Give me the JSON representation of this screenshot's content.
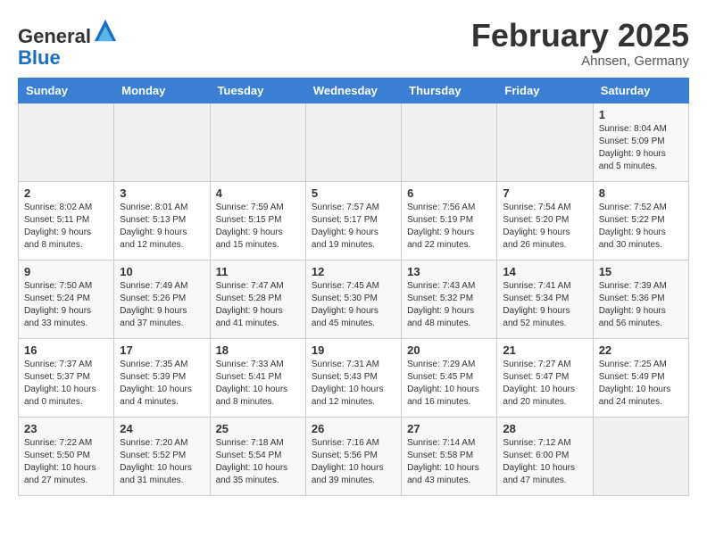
{
  "logo": {
    "general": "General",
    "blue": "Blue"
  },
  "header": {
    "month_year": "February 2025",
    "location": "Ahnsen, Germany"
  },
  "weekdays": [
    "Sunday",
    "Monday",
    "Tuesday",
    "Wednesday",
    "Thursday",
    "Friday",
    "Saturday"
  ],
  "weeks": [
    [
      {
        "day": "",
        "info": ""
      },
      {
        "day": "",
        "info": ""
      },
      {
        "day": "",
        "info": ""
      },
      {
        "day": "",
        "info": ""
      },
      {
        "day": "",
        "info": ""
      },
      {
        "day": "",
        "info": ""
      },
      {
        "day": "1",
        "info": "Sunrise: 8:04 AM\nSunset: 5:09 PM\nDaylight: 9 hours and 5 minutes."
      }
    ],
    [
      {
        "day": "2",
        "info": "Sunrise: 8:02 AM\nSunset: 5:11 PM\nDaylight: 9 hours and 8 minutes."
      },
      {
        "day": "3",
        "info": "Sunrise: 8:01 AM\nSunset: 5:13 PM\nDaylight: 9 hours and 12 minutes."
      },
      {
        "day": "4",
        "info": "Sunrise: 7:59 AM\nSunset: 5:15 PM\nDaylight: 9 hours and 15 minutes."
      },
      {
        "day": "5",
        "info": "Sunrise: 7:57 AM\nSunset: 5:17 PM\nDaylight: 9 hours and 19 minutes."
      },
      {
        "day": "6",
        "info": "Sunrise: 7:56 AM\nSunset: 5:19 PM\nDaylight: 9 hours and 22 minutes."
      },
      {
        "day": "7",
        "info": "Sunrise: 7:54 AM\nSunset: 5:20 PM\nDaylight: 9 hours and 26 minutes."
      },
      {
        "day": "8",
        "info": "Sunrise: 7:52 AM\nSunset: 5:22 PM\nDaylight: 9 hours and 30 minutes."
      }
    ],
    [
      {
        "day": "9",
        "info": "Sunrise: 7:50 AM\nSunset: 5:24 PM\nDaylight: 9 hours and 33 minutes."
      },
      {
        "day": "10",
        "info": "Sunrise: 7:49 AM\nSunset: 5:26 PM\nDaylight: 9 hours and 37 minutes."
      },
      {
        "day": "11",
        "info": "Sunrise: 7:47 AM\nSunset: 5:28 PM\nDaylight: 9 hours and 41 minutes."
      },
      {
        "day": "12",
        "info": "Sunrise: 7:45 AM\nSunset: 5:30 PM\nDaylight: 9 hours and 45 minutes."
      },
      {
        "day": "13",
        "info": "Sunrise: 7:43 AM\nSunset: 5:32 PM\nDaylight: 9 hours and 48 minutes."
      },
      {
        "day": "14",
        "info": "Sunrise: 7:41 AM\nSunset: 5:34 PM\nDaylight: 9 hours and 52 minutes."
      },
      {
        "day": "15",
        "info": "Sunrise: 7:39 AM\nSunset: 5:36 PM\nDaylight: 9 hours and 56 minutes."
      }
    ],
    [
      {
        "day": "16",
        "info": "Sunrise: 7:37 AM\nSunset: 5:37 PM\nDaylight: 10 hours and 0 minutes."
      },
      {
        "day": "17",
        "info": "Sunrise: 7:35 AM\nSunset: 5:39 PM\nDaylight: 10 hours and 4 minutes."
      },
      {
        "day": "18",
        "info": "Sunrise: 7:33 AM\nSunset: 5:41 PM\nDaylight: 10 hours and 8 minutes."
      },
      {
        "day": "19",
        "info": "Sunrise: 7:31 AM\nSunset: 5:43 PM\nDaylight: 10 hours and 12 minutes."
      },
      {
        "day": "20",
        "info": "Sunrise: 7:29 AM\nSunset: 5:45 PM\nDaylight: 10 hours and 16 minutes."
      },
      {
        "day": "21",
        "info": "Sunrise: 7:27 AM\nSunset: 5:47 PM\nDaylight: 10 hours and 20 minutes."
      },
      {
        "day": "22",
        "info": "Sunrise: 7:25 AM\nSunset: 5:49 PM\nDaylight: 10 hours and 24 minutes."
      }
    ],
    [
      {
        "day": "23",
        "info": "Sunrise: 7:22 AM\nSunset: 5:50 PM\nDaylight: 10 hours and 27 minutes."
      },
      {
        "day": "24",
        "info": "Sunrise: 7:20 AM\nSunset: 5:52 PM\nDaylight: 10 hours and 31 minutes."
      },
      {
        "day": "25",
        "info": "Sunrise: 7:18 AM\nSunset: 5:54 PM\nDaylight: 10 hours and 35 minutes."
      },
      {
        "day": "26",
        "info": "Sunrise: 7:16 AM\nSunset: 5:56 PM\nDaylight: 10 hours and 39 minutes."
      },
      {
        "day": "27",
        "info": "Sunrise: 7:14 AM\nSunset: 5:58 PM\nDaylight: 10 hours and 43 minutes."
      },
      {
        "day": "28",
        "info": "Sunrise: 7:12 AM\nSunset: 6:00 PM\nDaylight: 10 hours and 47 minutes."
      },
      {
        "day": "",
        "info": ""
      }
    ]
  ]
}
